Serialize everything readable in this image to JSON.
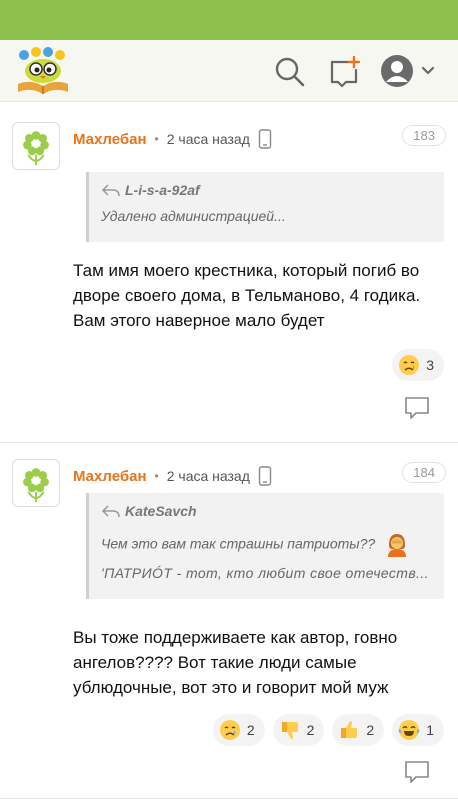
{
  "colors": {
    "status_bar": "#8fbf4c",
    "author": "#e8731a",
    "accent_icon": "#e8731a"
  },
  "header": {
    "logo": "owl-book-logo",
    "icons": [
      "search-icon",
      "new-post-icon",
      "user-avatar-icon",
      "chevron-down-icon"
    ]
  },
  "comments": [
    {
      "author": "Махлебан",
      "time": "2 часа назад",
      "number": "183",
      "quote_author": "L-i-s-a-92af",
      "quote_text": "Удалено администрацией...",
      "body": "Там имя моего крестника, который погиб во дворе своего дома, в Тельманово, 4 годика. Вам этого наверное мало будет",
      "reactions": [
        {
          "icon": "crying-face-emoji",
          "count": "3"
        }
      ]
    },
    {
      "author": "Махлебан",
      "time": "2 часа назад",
      "number": "184",
      "quote_author": "KateSavch",
      "quote_text": "Чем это вам так страшны патриоты??",
      "quote_text2": "'ПАТРИÓТ - тот, кто любит свое отечеств...",
      "body": "Вы тоже поддерживаете как автор, говно ангелов???? Вот такие люди самые ублюдочные, вот это и говорит мой муж",
      "reactions": [
        {
          "icon": "crying-face-emoji",
          "count": "2"
        },
        {
          "icon": "thumbs-down-emoji",
          "count": "2"
        },
        {
          "icon": "thumbs-up-emoji",
          "count": "2"
        },
        {
          "icon": "tears-of-joy-emoji",
          "count": "1"
        }
      ]
    }
  ]
}
